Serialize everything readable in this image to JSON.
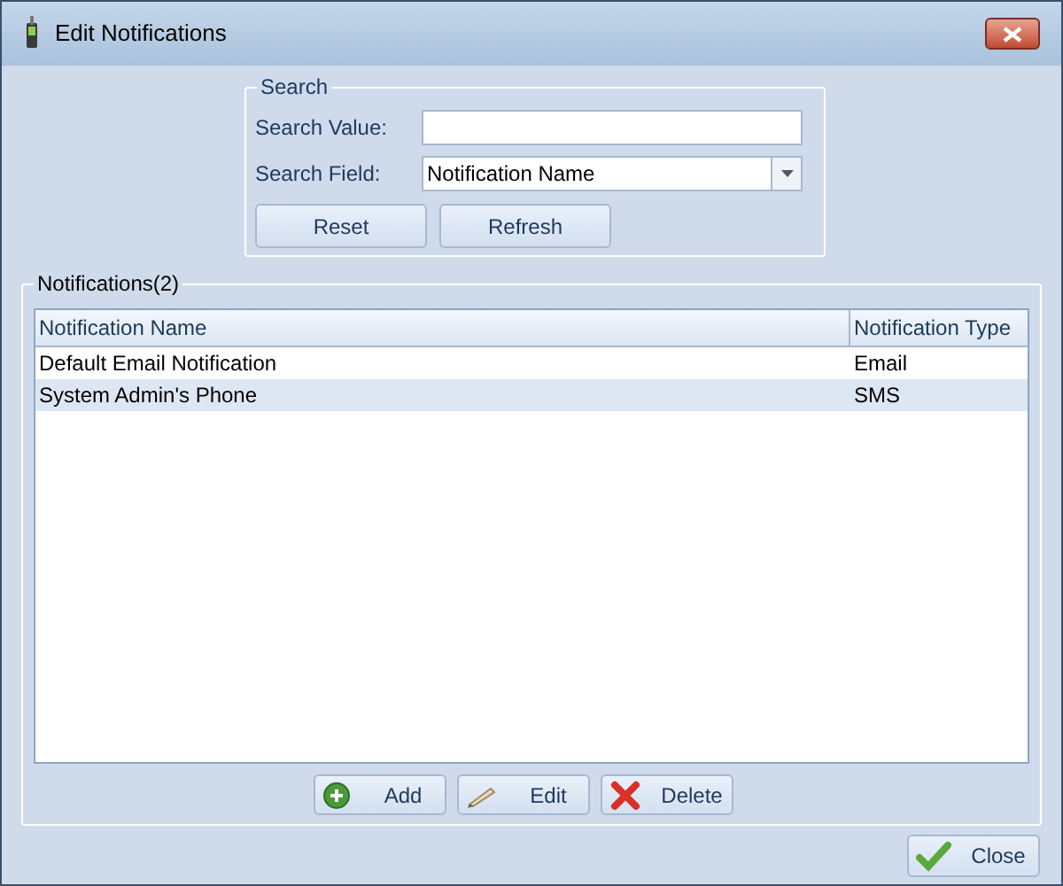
{
  "window": {
    "title": "Edit Notifications"
  },
  "search": {
    "title": "Search",
    "value_label": "Search Value:",
    "field_label": "Search Field:",
    "field_value": "Notification Name",
    "buttons": [
      "Reset",
      "Refresh"
    ]
  },
  "notifications": {
    "title": "Notifications(2)",
    "columns": [
      "Notification Name",
      "Notification Type"
    ],
    "rows": [
      {
        "name": "Default Email Notification",
        "type": "Email"
      },
      {
        "name": "System Admin's Phone",
        "type": "SMS"
      }
    ],
    "buttons": [
      {
        "kind": "add",
        "label": "Add"
      },
      {
        "kind": "edit",
        "label": "Edit"
      },
      {
        "kind": "delete",
        "label": "Delete"
      }
    ]
  },
  "close_button": "Close"
}
